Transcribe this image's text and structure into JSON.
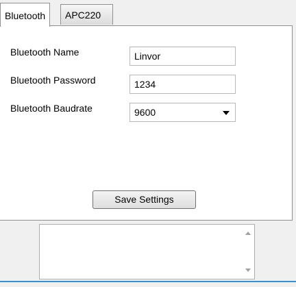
{
  "tabs": [
    {
      "label": "Bluetooth",
      "active": true
    },
    {
      "label": "APC220",
      "active": false
    }
  ],
  "form": {
    "name_label": "Bluetooth Name",
    "name_value": "Linvor",
    "password_label": "Bluetooth Password",
    "password_value": "1234",
    "baudrate_label": "Bluetooth Baudrate",
    "baudrate_value": "9600",
    "save_label": "Save Settings"
  },
  "log": {
    "text": ""
  },
  "colors": {
    "accent": "#3b8fcf",
    "border": "#8e8f8f"
  }
}
